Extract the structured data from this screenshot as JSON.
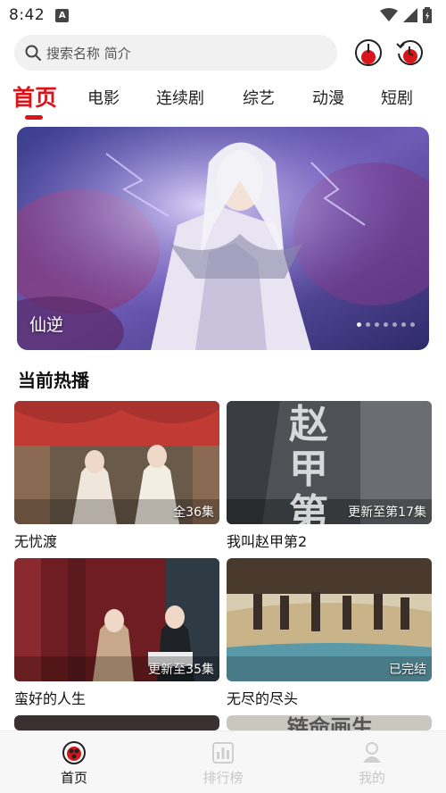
{
  "status_bar": {
    "time": "8:42",
    "notification_glyph": "A"
  },
  "search": {
    "placeholder": "搜索名称 简介"
  },
  "tabs": [
    {
      "label": "首页",
      "active": true
    },
    {
      "label": "电影"
    },
    {
      "label": "连续剧"
    },
    {
      "label": "综艺"
    },
    {
      "label": "动漫"
    },
    {
      "label": "短剧"
    }
  ],
  "banner": {
    "caption": "仙逆",
    "slide_count": 7,
    "active_slide": 1
  },
  "section": {
    "title": "当前热播"
  },
  "cards": [
    {
      "name": "无忧渡",
      "badge": "全36集"
    },
    {
      "name": "我叫赵甲第2",
      "badge": "更新至第17集",
      "poster_text": "赵甲第"
    },
    {
      "name": "蛮好的人生",
      "badge": "更新至35集"
    },
    {
      "name": "无尽的尽头",
      "badge": "已完结"
    }
  ],
  "partial_poster_text": "链命画生",
  "bottom_nav": [
    {
      "label": "首页",
      "icon": "home-icon",
      "active": true
    },
    {
      "label": "排行榜",
      "icon": "ranking-icon"
    },
    {
      "label": "我的",
      "icon": "profile-icon"
    }
  ],
  "colors": {
    "accent": "#d9141a"
  }
}
